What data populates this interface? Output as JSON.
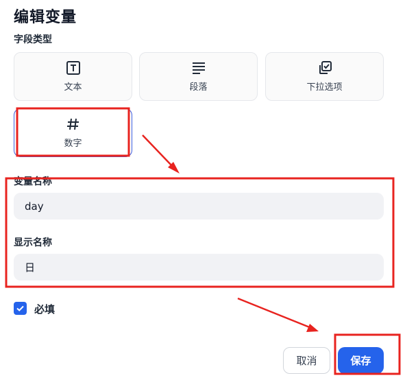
{
  "dialog": {
    "title": "编辑变量",
    "field_type_label": "字段类型"
  },
  "field_types": [
    {
      "label": "文本",
      "icon": "text-icon",
      "selected": false
    },
    {
      "label": "段落",
      "icon": "paragraph-icon",
      "selected": false
    },
    {
      "label": "下拉选项",
      "icon": "dropdown-options-icon",
      "selected": false
    },
    {
      "label": "数字",
      "icon": "hash-icon",
      "selected": true
    }
  ],
  "variable_name": {
    "label": "变量名称",
    "value": "day"
  },
  "display_name": {
    "label": "显示名称",
    "value": "日"
  },
  "required": {
    "label": "必填",
    "checked": true
  },
  "actions": {
    "cancel_label": "取消",
    "save_label": "保存"
  },
  "colors": {
    "accent": "#2563eb",
    "annotation": "#e8231f"
  }
}
